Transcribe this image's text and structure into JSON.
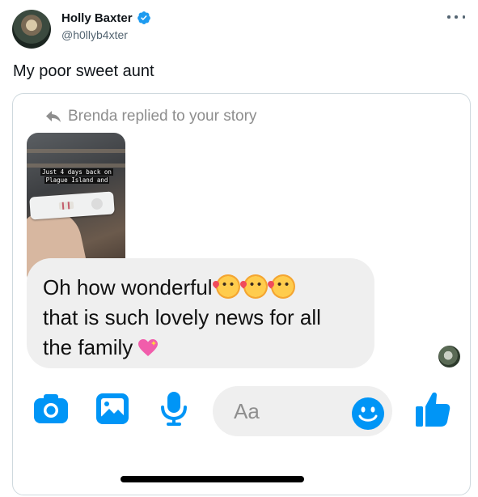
{
  "tweet": {
    "author_name": "Holly Baxter",
    "author_handle": "@h0llyb4xter",
    "verified": true,
    "text": "My poor sweet aunt",
    "more_icon": "ellipsis-icon"
  },
  "screenshot": {
    "reply_header": "Brenda replied to your story",
    "story_caption_line1": "Just 4 days back on",
    "story_caption_line2": "Plague Island and",
    "message_line1": "Oh how wonderful",
    "message_line2": "that is such lovely news for all",
    "message_line3": "the family",
    "message_emojis": [
      "smiling-face-with-hearts",
      "smiling-face-with-hearts",
      "smiling-face-with-hearts",
      "sparkling-heart"
    ],
    "composer_placeholder": "Aa",
    "toolbar_icons": [
      "camera-icon",
      "gallery-icon",
      "microphone-icon",
      "emoji-icon",
      "thumbs-up-icon"
    ]
  },
  "colors": {
    "accent": "#0095f6",
    "verified": "#1d9bf0",
    "secondary_text": "#536471",
    "bubble": "#efefef"
  }
}
